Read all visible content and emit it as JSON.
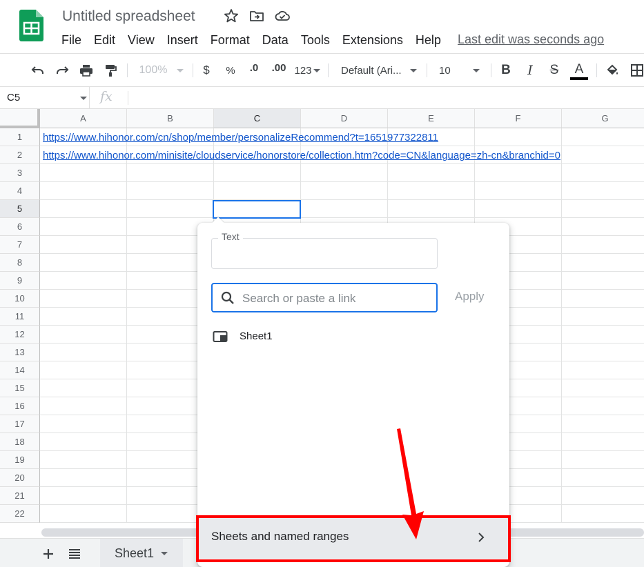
{
  "app": {
    "title": "Untitled spreadsheet",
    "last_edit": "Last edit was seconds ago"
  },
  "menu": [
    "File",
    "Edit",
    "View",
    "Insert",
    "Format",
    "Data",
    "Tools",
    "Extensions",
    "Help"
  ],
  "toolbar": {
    "zoom": "100%",
    "currency": "$",
    "percent": "%",
    "decrease_decimal": ".0",
    "increase_decimal": ".00",
    "number_format": "123",
    "font": "Default (Ari...",
    "font_size": "10",
    "bold": "B",
    "italic": "I",
    "strikethrough": "S",
    "text_color": "A",
    "text_color_swatch": "#000000"
  },
  "formula_bar": {
    "name_box": "C5",
    "fx_icon": "fx"
  },
  "grid": {
    "columns": [
      "A",
      "B",
      "C",
      "D",
      "E",
      "F",
      "G"
    ],
    "selected_column": "C",
    "rows": [
      "1",
      "2",
      "3",
      "4",
      "5",
      "6",
      "7",
      "8",
      "9",
      "10",
      "11",
      "12",
      "13",
      "14",
      "15",
      "16",
      "17",
      "18",
      "19",
      "20",
      "21",
      "22"
    ],
    "selected_row": "5",
    "cells": {
      "A1": "https://www.hihonor.com/cn/shop/member/personalizeRecommend?t=1651977322811",
      "A2": "https://www.hihonor.com/minisite/cloudservice/honorstore/collection.htm?code=CN&language=zh-cn&branchid=0"
    }
  },
  "bottom_bar": {
    "sheet_tab": "Sheet1"
  },
  "link_popup": {
    "text_label": "Text",
    "text_value": "",
    "search_placeholder": "Search or paste a link",
    "apply_label": "Apply",
    "sheet_result": "Sheet1",
    "named_ranges_label": "Sheets and named ranges"
  },
  "colors": {
    "accent": "#1a73e8",
    "link": "#1155cc",
    "logo_green": "#0f9d58",
    "annotation_red": "#ff0000"
  },
  "icons": [
    "sheets-logo-icon",
    "star-icon",
    "move-to-folder-icon",
    "cloud-saved-icon",
    "undo-icon",
    "redo-icon",
    "print-icon",
    "paint-format-icon",
    "fill-color-icon",
    "borders-icon",
    "search-icon",
    "sheet-icon",
    "chevron-right-icon",
    "add-icon",
    "list-icon"
  ]
}
